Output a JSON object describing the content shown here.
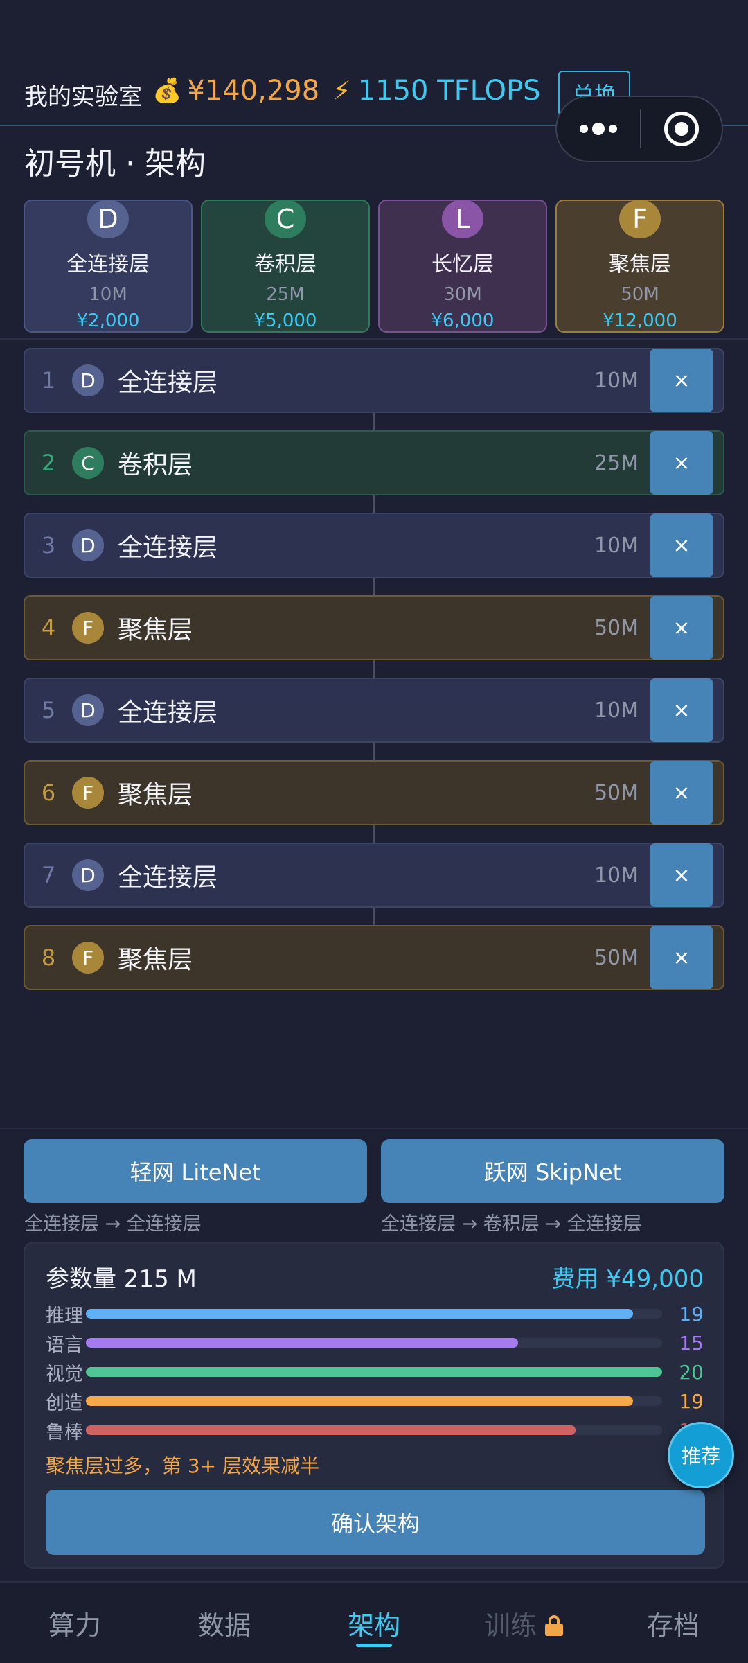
{
  "header": {
    "lab_title": "我的实验室",
    "money_icon": "💰",
    "money": "¥140,298",
    "compute_icon": "⚡",
    "compute": "1150 TFLOPS",
    "exchange_label": "兑换"
  },
  "page_title": "初号机 · 架构",
  "palette": [
    {
      "letter": "D",
      "name": "全连接层",
      "size": "10M",
      "price": "¥2,000",
      "color": "#56628f",
      "bg": "#353b5e",
      "border": "#4c5785"
    },
    {
      "letter": "C",
      "name": "卷积层",
      "size": "25M",
      "price": "¥5,000",
      "color": "#2e7d5e",
      "bg": "#24443e",
      "border": "#2f7a5b"
    },
    {
      "letter": "L",
      "name": "长忆层",
      "size": "30M",
      "price": "¥6,000",
      "color": "#8a55a6",
      "bg": "#40304f",
      "border": "#7a4f96"
    },
    {
      "letter": "F",
      "name": "聚焦层",
      "size": "50M",
      "price": "¥12,000",
      "color": "#a8863a",
      "bg": "#4a3f2e",
      "border": "#9b7d3c"
    }
  ],
  "layers": [
    {
      "index": "1",
      "letter": "D",
      "name": "全连接层",
      "size": "10M",
      "delete_label": "×"
    },
    {
      "index": "2",
      "letter": "C",
      "name": "卷积层",
      "size": "25M",
      "delete_label": "×"
    },
    {
      "index": "3",
      "letter": "D",
      "name": "全连接层",
      "size": "10M",
      "delete_label": "×"
    },
    {
      "index": "4",
      "letter": "F",
      "name": "聚焦层",
      "size": "50M",
      "delete_label": "×"
    },
    {
      "index": "5",
      "letter": "D",
      "name": "全连接层",
      "size": "10M",
      "delete_label": "×"
    },
    {
      "index": "6",
      "letter": "F",
      "name": "聚焦层",
      "size": "50M",
      "delete_label": "×"
    },
    {
      "index": "7",
      "letter": "D",
      "name": "全连接层",
      "size": "10M",
      "delete_label": "×"
    },
    {
      "index": "8",
      "letter": "F",
      "name": "聚焦层",
      "size": "50M",
      "delete_label": "×"
    }
  ],
  "layer_styles": {
    "D": {
      "bg": "#2d3250",
      "border": "#3d4566",
      "badge": "#56628f",
      "idx": "#6f7aa6"
    },
    "C": {
      "bg": "#223b37",
      "border": "#2d5a4c",
      "badge": "#2e7d5e",
      "idx": "#3aa77a"
    },
    "F": {
      "bg": "#3d3529",
      "border": "#6b5a32",
      "badge": "#a8863a",
      "idx": "#c29a44"
    }
  },
  "presets": [
    {
      "label": "轻网 LiteNet",
      "desc": "全连接层 → 全连接层"
    },
    {
      "label": "跃网 SkipNet",
      "desc": "全连接层 → 卷积层 → 全连接层"
    }
  ],
  "summary": {
    "params": "参数量 215 M",
    "cost": "费用 ¥49,000",
    "stats": [
      {
        "name": "推理",
        "value": 19,
        "label": "19",
        "fraction": 0.95,
        "color": "#5fb0f5"
      },
      {
        "name": "语言",
        "value": 15,
        "label": "15",
        "fraction": 0.75,
        "color": "#a57cf0"
      },
      {
        "name": "视觉",
        "value": 20,
        "label": "20",
        "fraction": 1.0,
        "color": "#4fc495"
      },
      {
        "name": "创造",
        "value": 19,
        "label": "19",
        "fraction": 0.95,
        "color": "#f5a94a"
      },
      {
        "name": "鲁棒",
        "value": 17,
        "label": "17",
        "fraction": 0.85,
        "color": "#d06262"
      }
    ],
    "warning": "聚焦层过多，第 3+ 层效果减半",
    "confirm_label": "确认架构"
  },
  "recommend_label": "推荐",
  "nav": [
    {
      "label": "算力",
      "state": "normal"
    },
    {
      "label": "数据",
      "state": "normal"
    },
    {
      "label": "架构",
      "state": "active"
    },
    {
      "label": "训练",
      "state": "locked"
    },
    {
      "label": "存档",
      "state": "normal"
    }
  ]
}
